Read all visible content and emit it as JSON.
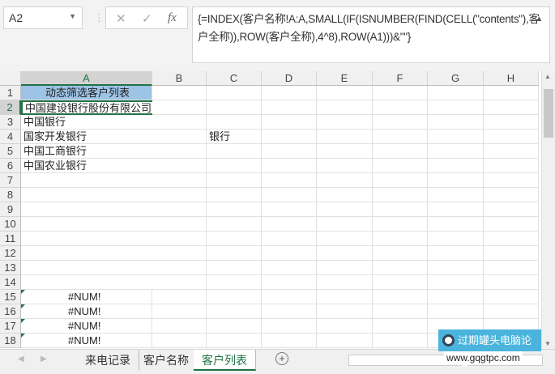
{
  "name_box": "A2",
  "formula_icons": [
    "cancel-icon",
    "confirm-icon",
    "fx-icon"
  ],
  "fx_label": "fx",
  "formula": "{=INDEX(客户名称!A:A,SMALL(IF(ISNUMBER(FIND(CELL(\"contents\"),客户全称)),ROW(客户全称),4^8),ROW(A1)))&\"\"}",
  "columns": [
    "A",
    "B",
    "C",
    "D",
    "E",
    "F",
    "G",
    "H"
  ],
  "rows": [
    "1",
    "2",
    "3",
    "4",
    "5",
    "6",
    "7",
    "8",
    "9",
    "10",
    "11",
    "12",
    "13",
    "14",
    "15",
    "16",
    "17",
    "18"
  ],
  "cells": {
    "A1": "动态筛选客户列表",
    "A2": "中国建设银行股份有限公司",
    "A3": "中国银行",
    "A4": "国家开发银行",
    "A5": "中国工商银行",
    "A6": "中国农业银行",
    "C4": "银行",
    "A15": "#NUM!",
    "A16": "#NUM!",
    "A17": "#NUM!",
    "A18": "#NUM!"
  },
  "tabs": [
    "来电记录",
    "客户名称",
    "客户列表"
  ],
  "active_tab": "客户列表",
  "watermark": {
    "title": "过期罐头电脑论坛",
    "url": "www.gqgtpc.com"
  },
  "colors": {
    "accent": "#217346",
    "header_fill": "#9dc3e6"
  }
}
